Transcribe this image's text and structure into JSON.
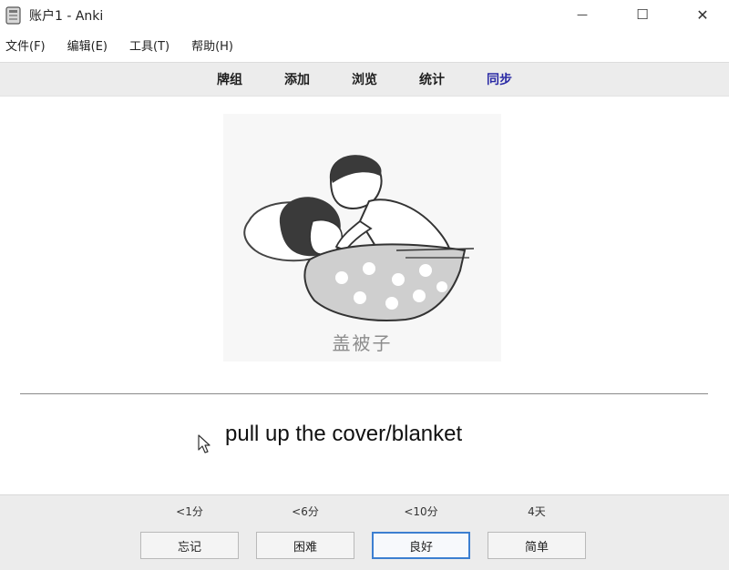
{
  "window": {
    "title": "账户1 - Anki",
    "minimize_glyph": "—",
    "maximize_glyph": "☐",
    "close_glyph": "✕"
  },
  "menu": {
    "items": [
      {
        "label": "文件(F)"
      },
      {
        "label": "编辑(E)"
      },
      {
        "label": "工具(T)"
      },
      {
        "label": "帮助(H)"
      }
    ]
  },
  "toolbar": {
    "items": [
      {
        "label": "牌组"
      },
      {
        "label": "添加"
      },
      {
        "label": "浏览"
      },
      {
        "label": "统计"
      },
      {
        "label": "同步"
      }
    ]
  },
  "card": {
    "image_caption": "盖被子",
    "answer_text": "pull up the cover/blanket",
    "image_icon": "illustration-boy-covering-girl-with-blanket"
  },
  "answer_buttons": [
    {
      "interval": "<1分",
      "label": "忘记"
    },
    {
      "interval": "<6分",
      "label": "困难"
    },
    {
      "interval": "<10分",
      "label": "良好"
    },
    {
      "interval": "4天",
      "label": "简单"
    }
  ],
  "colors": {
    "sync_link": "#2a2aa5",
    "default_button_border": "#3c7fd1",
    "toolbar_bg": "#ececec"
  }
}
